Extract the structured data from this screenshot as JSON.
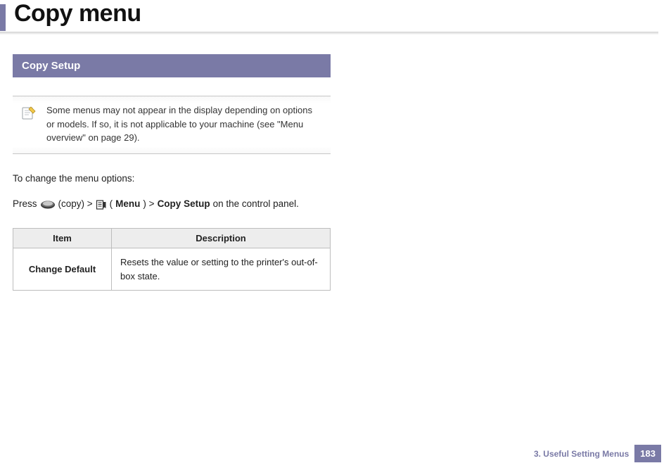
{
  "title": "Copy menu",
  "section_header": "Copy Setup",
  "note": "Some menus may not appear in the display depending on options or models. If so, it is not applicable to your machine (see \"Menu overview\" on page 29).",
  "intro": "To change the menu options:",
  "press_line": {
    "p1": "Press",
    "copy_label": "(copy) >",
    "menu_label_open": "(",
    "menu_label_bold": "Menu",
    "menu_label_close": ") >",
    "setup_bold": "Copy Setup",
    "tail": "on the control panel."
  },
  "table": {
    "headers": {
      "item": "Item",
      "desc": "Description"
    },
    "rows": [
      {
        "item": "Change Default",
        "desc": "Resets the value or setting to the printer's out-of-box state."
      }
    ]
  },
  "footer": {
    "chapter": "3.  Useful Setting Menus",
    "page": "183"
  }
}
